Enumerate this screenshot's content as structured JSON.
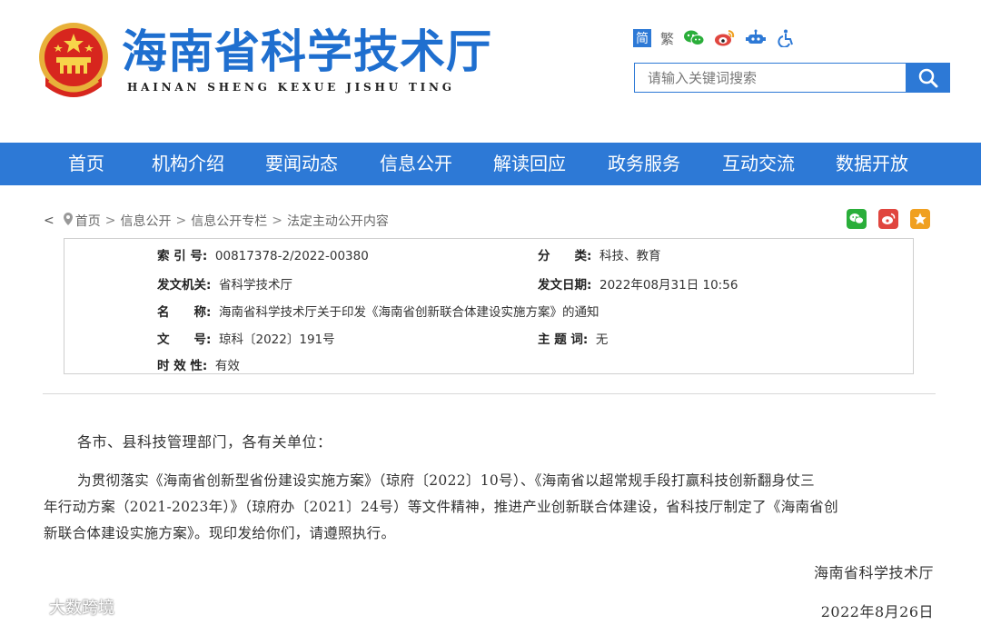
{
  "header": {
    "title_cn": "海南省科学技术厅",
    "title_en": "HAINAN SHENG KEXUE JISHU TING",
    "tools": {
      "simplified": "简",
      "traditional": "繁",
      "icons": [
        "wechat-icon",
        "weibo-icon",
        "robot-icon",
        "accessibility-icon"
      ]
    },
    "search": {
      "placeholder": "请输入关键词搜索"
    }
  },
  "nav": {
    "items": [
      {
        "label": "首页"
      },
      {
        "label": "机构介绍"
      },
      {
        "label": "要闻动态"
      },
      {
        "label": "信息公开"
      },
      {
        "label": "解读回应"
      },
      {
        "label": "政务服务"
      },
      {
        "label": "互动交流"
      },
      {
        "label": "数据开放"
      }
    ]
  },
  "breadcrumb": {
    "back": "<",
    "items": [
      "首页",
      "信息公开",
      "信息公开专栏",
      "法定主动公开内容"
    ],
    "separator": ">"
  },
  "meta": {
    "index_label": "索 引 号:",
    "index_value": "00817378-2/2022-00380",
    "category_label": "分　　类:",
    "category_value": "科技、教育",
    "issuer_label": "发文机关:",
    "issuer_value": "省科学技术厅",
    "date_label": "发文日期:",
    "date_value": "2022年08月31日 10:56",
    "name_label": "名　　称:",
    "name_value": "海南省科学技术厅关于印发《海南省创新联合体建设实施方案》的通知",
    "docno_label": "文　　号:",
    "docno_value": "琼科〔2022〕191号",
    "subject_label": "主 题 词:",
    "subject_value": "无",
    "validity_label": "时 效 性:",
    "validity_value": "有效"
  },
  "article": {
    "salutation": "各市、县科技管理部门，各有关单位：",
    "para1_line1": "为贯彻落实《海南省创新型省份建设实施方案》（琼府〔2022〕10号）、《海南省以超常规手段打赢科技创新翻身仗三",
    "para1_line2": "年行动方案（2021-2023年）》（琼府办〔2021〕24号）等文件精神，推进产业创新联合体建设，省科技厅制定了《海南省创",
    "para1_line3": "新联合体建设实施方案》。现印发给你们，请遵照执行。",
    "signature": "海南省科学技术厅",
    "date": "2022年8月26日"
  },
  "watermark": "大数跨境",
  "colors": {
    "brand_blue": "#2d79d6",
    "logo_blue": "#1f6fcf",
    "wechat_green": "#2aae3a",
    "weibo_red": "#e0463f",
    "favorite_orange": "#f0a020"
  }
}
